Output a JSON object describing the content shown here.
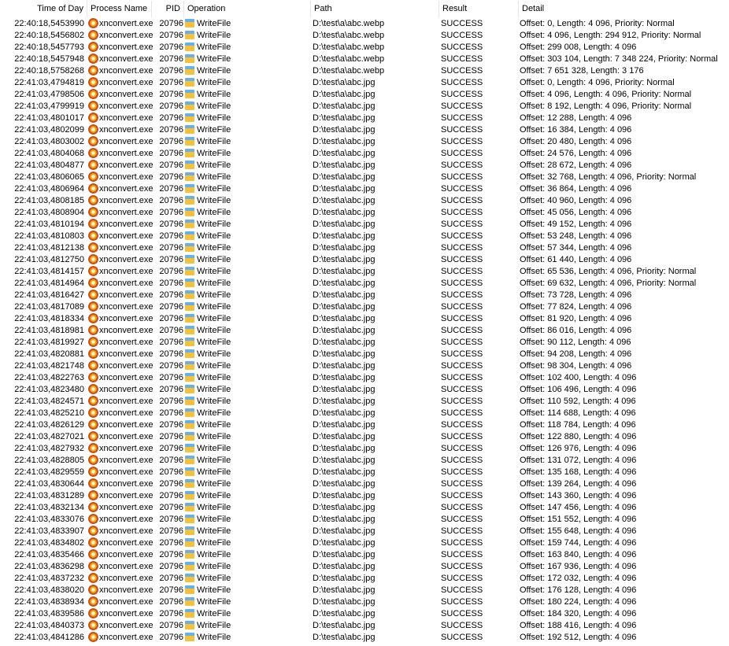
{
  "columns": {
    "time": "Time of Day",
    "process": "Process Name",
    "pid": "PID",
    "operation": "Operation",
    "path": "Path",
    "result": "Result",
    "detail": "Detail"
  },
  "icons": {
    "process": "xnconvert-process-icon",
    "operation": "file-system-write-icon"
  },
  "rows": [
    {
      "time": "22:40:18,5453990",
      "process": "xnconvert.exe",
      "pid": "20796",
      "operation": "WriteFile",
      "path": "D:\\test\\a\\abc.webp",
      "result": "SUCCESS",
      "detail": "Offset: 0, Length: 4 096, Priority: Normal"
    },
    {
      "time": "22:40:18,5456802",
      "process": "xnconvert.exe",
      "pid": "20796",
      "operation": "WriteFile",
      "path": "D:\\test\\a\\abc.webp",
      "result": "SUCCESS",
      "detail": "Offset: 4 096, Length: 294 912, Priority: Normal"
    },
    {
      "time": "22:40:18,5457793",
      "process": "xnconvert.exe",
      "pid": "20796",
      "operation": "WriteFile",
      "path": "D:\\test\\a\\abc.webp",
      "result": "SUCCESS",
      "detail": "Offset: 299 008, Length: 4 096"
    },
    {
      "time": "22:40:18,5457948",
      "process": "xnconvert.exe",
      "pid": "20796",
      "operation": "WriteFile",
      "path": "D:\\test\\a\\abc.webp",
      "result": "SUCCESS",
      "detail": "Offset: 303 104, Length: 7 348 224, Priority: Normal"
    },
    {
      "time": "22:40:18,5758268",
      "process": "xnconvert.exe",
      "pid": "20796",
      "operation": "WriteFile",
      "path": "D:\\test\\a\\abc.webp",
      "result": "SUCCESS",
      "detail": "Offset: 7 651 328, Length: 3 176"
    },
    {
      "time": "22:41:03,4794819",
      "process": "xnconvert.exe",
      "pid": "20796",
      "operation": "WriteFile",
      "path": "D:\\test\\a\\abc.jpg",
      "result": "SUCCESS",
      "detail": "Offset: 0, Length: 4 096, Priority: Normal"
    },
    {
      "time": "22:41:03,4798506",
      "process": "xnconvert.exe",
      "pid": "20796",
      "operation": "WriteFile",
      "path": "D:\\test\\a\\abc.jpg",
      "result": "SUCCESS",
      "detail": "Offset: 4 096, Length: 4 096, Priority: Normal"
    },
    {
      "time": "22:41:03,4799919",
      "process": "xnconvert.exe",
      "pid": "20796",
      "operation": "WriteFile",
      "path": "D:\\test\\a\\abc.jpg",
      "result": "SUCCESS",
      "detail": "Offset: 8 192, Length: 4 096, Priority: Normal"
    },
    {
      "time": "22:41:03,4801017",
      "process": "xnconvert.exe",
      "pid": "20796",
      "operation": "WriteFile",
      "path": "D:\\test\\a\\abc.jpg",
      "result": "SUCCESS",
      "detail": "Offset: 12 288, Length: 4 096"
    },
    {
      "time": "22:41:03,4802099",
      "process": "xnconvert.exe",
      "pid": "20796",
      "operation": "WriteFile",
      "path": "D:\\test\\a\\abc.jpg",
      "result": "SUCCESS",
      "detail": "Offset: 16 384, Length: 4 096"
    },
    {
      "time": "22:41:03,4803002",
      "process": "xnconvert.exe",
      "pid": "20796",
      "operation": "WriteFile",
      "path": "D:\\test\\a\\abc.jpg",
      "result": "SUCCESS",
      "detail": "Offset: 20 480, Length: 4 096"
    },
    {
      "time": "22:41:03,4804068",
      "process": "xnconvert.exe",
      "pid": "20796",
      "operation": "WriteFile",
      "path": "D:\\test\\a\\abc.jpg",
      "result": "SUCCESS",
      "detail": "Offset: 24 576, Length: 4 096"
    },
    {
      "time": "22:41:03,4804877",
      "process": "xnconvert.exe",
      "pid": "20796",
      "operation": "WriteFile",
      "path": "D:\\test\\a\\abc.jpg",
      "result": "SUCCESS",
      "detail": "Offset: 28 672, Length: 4 096"
    },
    {
      "time": "22:41:03,4806065",
      "process": "xnconvert.exe",
      "pid": "20796",
      "operation": "WriteFile",
      "path": "D:\\test\\a\\abc.jpg",
      "result": "SUCCESS",
      "detail": "Offset: 32 768, Length: 4 096, Priority: Normal"
    },
    {
      "time": "22:41:03,4806964",
      "process": "xnconvert.exe",
      "pid": "20796",
      "operation": "WriteFile",
      "path": "D:\\test\\a\\abc.jpg",
      "result": "SUCCESS",
      "detail": "Offset: 36 864, Length: 4 096"
    },
    {
      "time": "22:41:03,4808185",
      "process": "xnconvert.exe",
      "pid": "20796",
      "operation": "WriteFile",
      "path": "D:\\test\\a\\abc.jpg",
      "result": "SUCCESS",
      "detail": "Offset: 40 960, Length: 4 096"
    },
    {
      "time": "22:41:03,4808904",
      "process": "xnconvert.exe",
      "pid": "20796",
      "operation": "WriteFile",
      "path": "D:\\test\\a\\abc.jpg",
      "result": "SUCCESS",
      "detail": "Offset: 45 056, Length: 4 096"
    },
    {
      "time": "22:41:03,4810194",
      "process": "xnconvert.exe",
      "pid": "20796",
      "operation": "WriteFile",
      "path": "D:\\test\\a\\abc.jpg",
      "result": "SUCCESS",
      "detail": "Offset: 49 152, Length: 4 096"
    },
    {
      "time": "22:41:03,4810803",
      "process": "xnconvert.exe",
      "pid": "20796",
      "operation": "WriteFile",
      "path": "D:\\test\\a\\abc.jpg",
      "result": "SUCCESS",
      "detail": "Offset: 53 248, Length: 4 096"
    },
    {
      "time": "22:41:03,4812138",
      "process": "xnconvert.exe",
      "pid": "20796",
      "operation": "WriteFile",
      "path": "D:\\test\\a\\abc.jpg",
      "result": "SUCCESS",
      "detail": "Offset: 57 344, Length: 4 096"
    },
    {
      "time": "22:41:03,4812750",
      "process": "xnconvert.exe",
      "pid": "20796",
      "operation": "WriteFile",
      "path": "D:\\test\\a\\abc.jpg",
      "result": "SUCCESS",
      "detail": "Offset: 61 440, Length: 4 096"
    },
    {
      "time": "22:41:03,4814157",
      "process": "xnconvert.exe",
      "pid": "20796",
      "operation": "WriteFile",
      "path": "D:\\test\\a\\abc.jpg",
      "result": "SUCCESS",
      "detail": "Offset: 65 536, Length: 4 096, Priority: Normal"
    },
    {
      "time": "22:41:03,4814964",
      "process": "xnconvert.exe",
      "pid": "20796",
      "operation": "WriteFile",
      "path": "D:\\test\\a\\abc.jpg",
      "result": "SUCCESS",
      "detail": "Offset: 69 632, Length: 4 096, Priority: Normal"
    },
    {
      "time": "22:41:03,4816427",
      "process": "xnconvert.exe",
      "pid": "20796",
      "operation": "WriteFile",
      "path": "D:\\test\\a\\abc.jpg",
      "result": "SUCCESS",
      "detail": "Offset: 73 728, Length: 4 096"
    },
    {
      "time": "22:41:03,4817089",
      "process": "xnconvert.exe",
      "pid": "20796",
      "operation": "WriteFile",
      "path": "D:\\test\\a\\abc.jpg",
      "result": "SUCCESS",
      "detail": "Offset: 77 824, Length: 4 096"
    },
    {
      "time": "22:41:03,4818334",
      "process": "xnconvert.exe",
      "pid": "20796",
      "operation": "WriteFile",
      "path": "D:\\test\\a\\abc.jpg",
      "result": "SUCCESS",
      "detail": "Offset: 81 920, Length: 4 096"
    },
    {
      "time": "22:41:03,4818981",
      "process": "xnconvert.exe",
      "pid": "20796",
      "operation": "WriteFile",
      "path": "D:\\test\\a\\abc.jpg",
      "result": "SUCCESS",
      "detail": "Offset: 86 016, Length: 4 096"
    },
    {
      "time": "22:41:03,4819927",
      "process": "xnconvert.exe",
      "pid": "20796",
      "operation": "WriteFile",
      "path": "D:\\test\\a\\abc.jpg",
      "result": "SUCCESS",
      "detail": "Offset: 90 112, Length: 4 096"
    },
    {
      "time": "22:41:03,4820881",
      "process": "xnconvert.exe",
      "pid": "20796",
      "operation": "WriteFile",
      "path": "D:\\test\\a\\abc.jpg",
      "result": "SUCCESS",
      "detail": "Offset: 94 208, Length: 4 096"
    },
    {
      "time": "22:41:03,4821748",
      "process": "xnconvert.exe",
      "pid": "20796",
      "operation": "WriteFile",
      "path": "D:\\test\\a\\abc.jpg",
      "result": "SUCCESS",
      "detail": "Offset: 98 304, Length: 4 096"
    },
    {
      "time": "22:41:03,4822763",
      "process": "xnconvert.exe",
      "pid": "20796",
      "operation": "WriteFile",
      "path": "D:\\test\\a\\abc.jpg",
      "result": "SUCCESS",
      "detail": "Offset: 102 400, Length: 4 096"
    },
    {
      "time": "22:41:03,4823480",
      "process": "xnconvert.exe",
      "pid": "20796",
      "operation": "WriteFile",
      "path": "D:\\test\\a\\abc.jpg",
      "result": "SUCCESS",
      "detail": "Offset: 106 496, Length: 4 096"
    },
    {
      "time": "22:41:03,4824571",
      "process": "xnconvert.exe",
      "pid": "20796",
      "operation": "WriteFile",
      "path": "D:\\test\\a\\abc.jpg",
      "result": "SUCCESS",
      "detail": "Offset: 110 592, Length: 4 096"
    },
    {
      "time": "22:41:03,4825210",
      "process": "xnconvert.exe",
      "pid": "20796",
      "operation": "WriteFile",
      "path": "D:\\test\\a\\abc.jpg",
      "result": "SUCCESS",
      "detail": "Offset: 114 688, Length: 4 096"
    },
    {
      "time": "22:41:03,4826129",
      "process": "xnconvert.exe",
      "pid": "20796",
      "operation": "WriteFile",
      "path": "D:\\test\\a\\abc.jpg",
      "result": "SUCCESS",
      "detail": "Offset: 118 784, Length: 4 096"
    },
    {
      "time": "22:41:03,4827021",
      "process": "xnconvert.exe",
      "pid": "20796",
      "operation": "WriteFile",
      "path": "D:\\test\\a\\abc.jpg",
      "result": "SUCCESS",
      "detail": "Offset: 122 880, Length: 4 096"
    },
    {
      "time": "22:41:03,4827932",
      "process": "xnconvert.exe",
      "pid": "20796",
      "operation": "WriteFile",
      "path": "D:\\test\\a\\abc.jpg",
      "result": "SUCCESS",
      "detail": "Offset: 126 976, Length: 4 096"
    },
    {
      "time": "22:41:03,4828805",
      "process": "xnconvert.exe",
      "pid": "20796",
      "operation": "WriteFile",
      "path": "D:\\test\\a\\abc.jpg",
      "result": "SUCCESS",
      "detail": "Offset: 131 072, Length: 4 096"
    },
    {
      "time": "22:41:03,4829559",
      "process": "xnconvert.exe",
      "pid": "20796",
      "operation": "WriteFile",
      "path": "D:\\test\\a\\abc.jpg",
      "result": "SUCCESS",
      "detail": "Offset: 135 168, Length: 4 096"
    },
    {
      "time": "22:41:03,4830644",
      "process": "xnconvert.exe",
      "pid": "20796",
      "operation": "WriteFile",
      "path": "D:\\test\\a\\abc.jpg",
      "result": "SUCCESS",
      "detail": "Offset: 139 264, Length: 4 096"
    },
    {
      "time": "22:41:03,4831289",
      "process": "xnconvert.exe",
      "pid": "20796",
      "operation": "WriteFile",
      "path": "D:\\test\\a\\abc.jpg",
      "result": "SUCCESS",
      "detail": "Offset: 143 360, Length: 4 096"
    },
    {
      "time": "22:41:03,4832134",
      "process": "xnconvert.exe",
      "pid": "20796",
      "operation": "WriteFile",
      "path": "D:\\test\\a\\abc.jpg",
      "result": "SUCCESS",
      "detail": "Offset: 147 456, Length: 4 096"
    },
    {
      "time": "22:41:03,4833076",
      "process": "xnconvert.exe",
      "pid": "20796",
      "operation": "WriteFile",
      "path": "D:\\test\\a\\abc.jpg",
      "result": "SUCCESS",
      "detail": "Offset: 151 552, Length: 4 096"
    },
    {
      "time": "22:41:03,4833907",
      "process": "xnconvert.exe",
      "pid": "20796",
      "operation": "WriteFile",
      "path": "D:\\test\\a\\abc.jpg",
      "result": "SUCCESS",
      "detail": "Offset: 155 648, Length: 4 096"
    },
    {
      "time": "22:41:03,4834802",
      "process": "xnconvert.exe",
      "pid": "20796",
      "operation": "WriteFile",
      "path": "D:\\test\\a\\abc.jpg",
      "result": "SUCCESS",
      "detail": "Offset: 159 744, Length: 4 096"
    },
    {
      "time": "22:41:03,4835466",
      "process": "xnconvert.exe",
      "pid": "20796",
      "operation": "WriteFile",
      "path": "D:\\test\\a\\abc.jpg",
      "result": "SUCCESS",
      "detail": "Offset: 163 840, Length: 4 096"
    },
    {
      "time": "22:41:03,4836298",
      "process": "xnconvert.exe",
      "pid": "20796",
      "operation": "WriteFile",
      "path": "D:\\test\\a\\abc.jpg",
      "result": "SUCCESS",
      "detail": "Offset: 167 936, Length: 4 096"
    },
    {
      "time": "22:41:03,4837232",
      "process": "xnconvert.exe",
      "pid": "20796",
      "operation": "WriteFile",
      "path": "D:\\test\\a\\abc.jpg",
      "result": "SUCCESS",
      "detail": "Offset: 172 032, Length: 4 096"
    },
    {
      "time": "22:41:03,4838020",
      "process": "xnconvert.exe",
      "pid": "20796",
      "operation": "WriteFile",
      "path": "D:\\test\\a\\abc.jpg",
      "result": "SUCCESS",
      "detail": "Offset: 176 128, Length: 4 096"
    },
    {
      "time": "22:41:03,4838934",
      "process": "xnconvert.exe",
      "pid": "20796",
      "operation": "WriteFile",
      "path": "D:\\test\\a\\abc.jpg",
      "result": "SUCCESS",
      "detail": "Offset: 180 224, Length: 4 096"
    },
    {
      "time": "22:41:03,4839586",
      "process": "xnconvert.exe",
      "pid": "20796",
      "operation": "WriteFile",
      "path": "D:\\test\\a\\abc.jpg",
      "result": "SUCCESS",
      "detail": "Offset: 184 320, Length: 4 096"
    },
    {
      "time": "22:41:03,4840373",
      "process": "xnconvert.exe",
      "pid": "20796",
      "operation": "WriteFile",
      "path": "D:\\test\\a\\abc.jpg",
      "result": "SUCCESS",
      "detail": "Offset: 188 416, Length: 4 096"
    },
    {
      "time": "22:41:03,4841286",
      "process": "xnconvert.exe",
      "pid": "20796",
      "operation": "WriteFile",
      "path": "D:\\test\\a\\abc.jpg",
      "result": "SUCCESS",
      "detail": "Offset: 192 512, Length: 4 096"
    }
  ]
}
